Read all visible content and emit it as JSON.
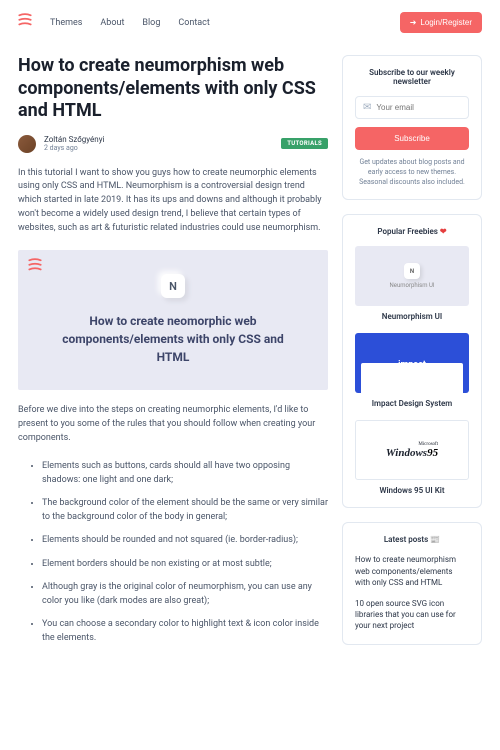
{
  "nav": {
    "themes": "Themes",
    "about": "About",
    "blog": "Blog",
    "contact": "Contact",
    "login": "Login/Register"
  },
  "article": {
    "title": "How to create neumorphism web components/elements with only CSS and HTML",
    "author": "Zoltán Szőgyényi",
    "date": "2 days ago",
    "badge": "TUTORIALS",
    "intro": "In this tutorial I want to show you guys how to create neumorphic elements using only CSS and HTML. Neumorphism is a controversial design trend which started in late 2019. It has its ups and downs and although it probably won't become a widely used design trend, I believe that certain types of websites, such as art & futuristic related industries could use neumorphism.",
    "heroIcon": "N",
    "heroTitle": "How to create neomorphic web components/elements with only CSS and HTML",
    "para2": "Before we dive into the steps on creating neumorphic elements, I'd like to present to you some of the rules that you should follow when creating your components.",
    "rules": [
      "Elements such as buttons, cards should all have two opposing shadows: one light and one dark;",
      "The background color of the element should be the same or very similar to the background color of the body in general;",
      "Elements should be rounded and not squared (ie. border-radius);",
      "Element borders should be non existing or at most subtle;",
      "Although gray is the original color of neumorphism, you can use any color you like (dark modes are also great);",
      "You can choose a secondary color to highlight text & icon color inside the elements."
    ]
  },
  "newsletter": {
    "title": "Subscribe to our weekly newsletter",
    "placeholder": "Your email",
    "button": "Subscribe",
    "note": "Get updates about blog posts and early access to new themes. Seasonal discounts also included."
  },
  "freebies": {
    "title": "Popular Freebies",
    "items": [
      {
        "label": "Neumorphism UI",
        "sub": "Neumorphism UI"
      },
      {
        "label": "Impact Design System",
        "brand": "impact"
      },
      {
        "label": "Windows 95 UI Kit"
      }
    ]
  },
  "latest": {
    "title": "Latest posts",
    "items": [
      "How to create neumorphism web components/elements with only CSS and HTML",
      "10 open source SVG icon libraries that you can use for your next project"
    ]
  }
}
